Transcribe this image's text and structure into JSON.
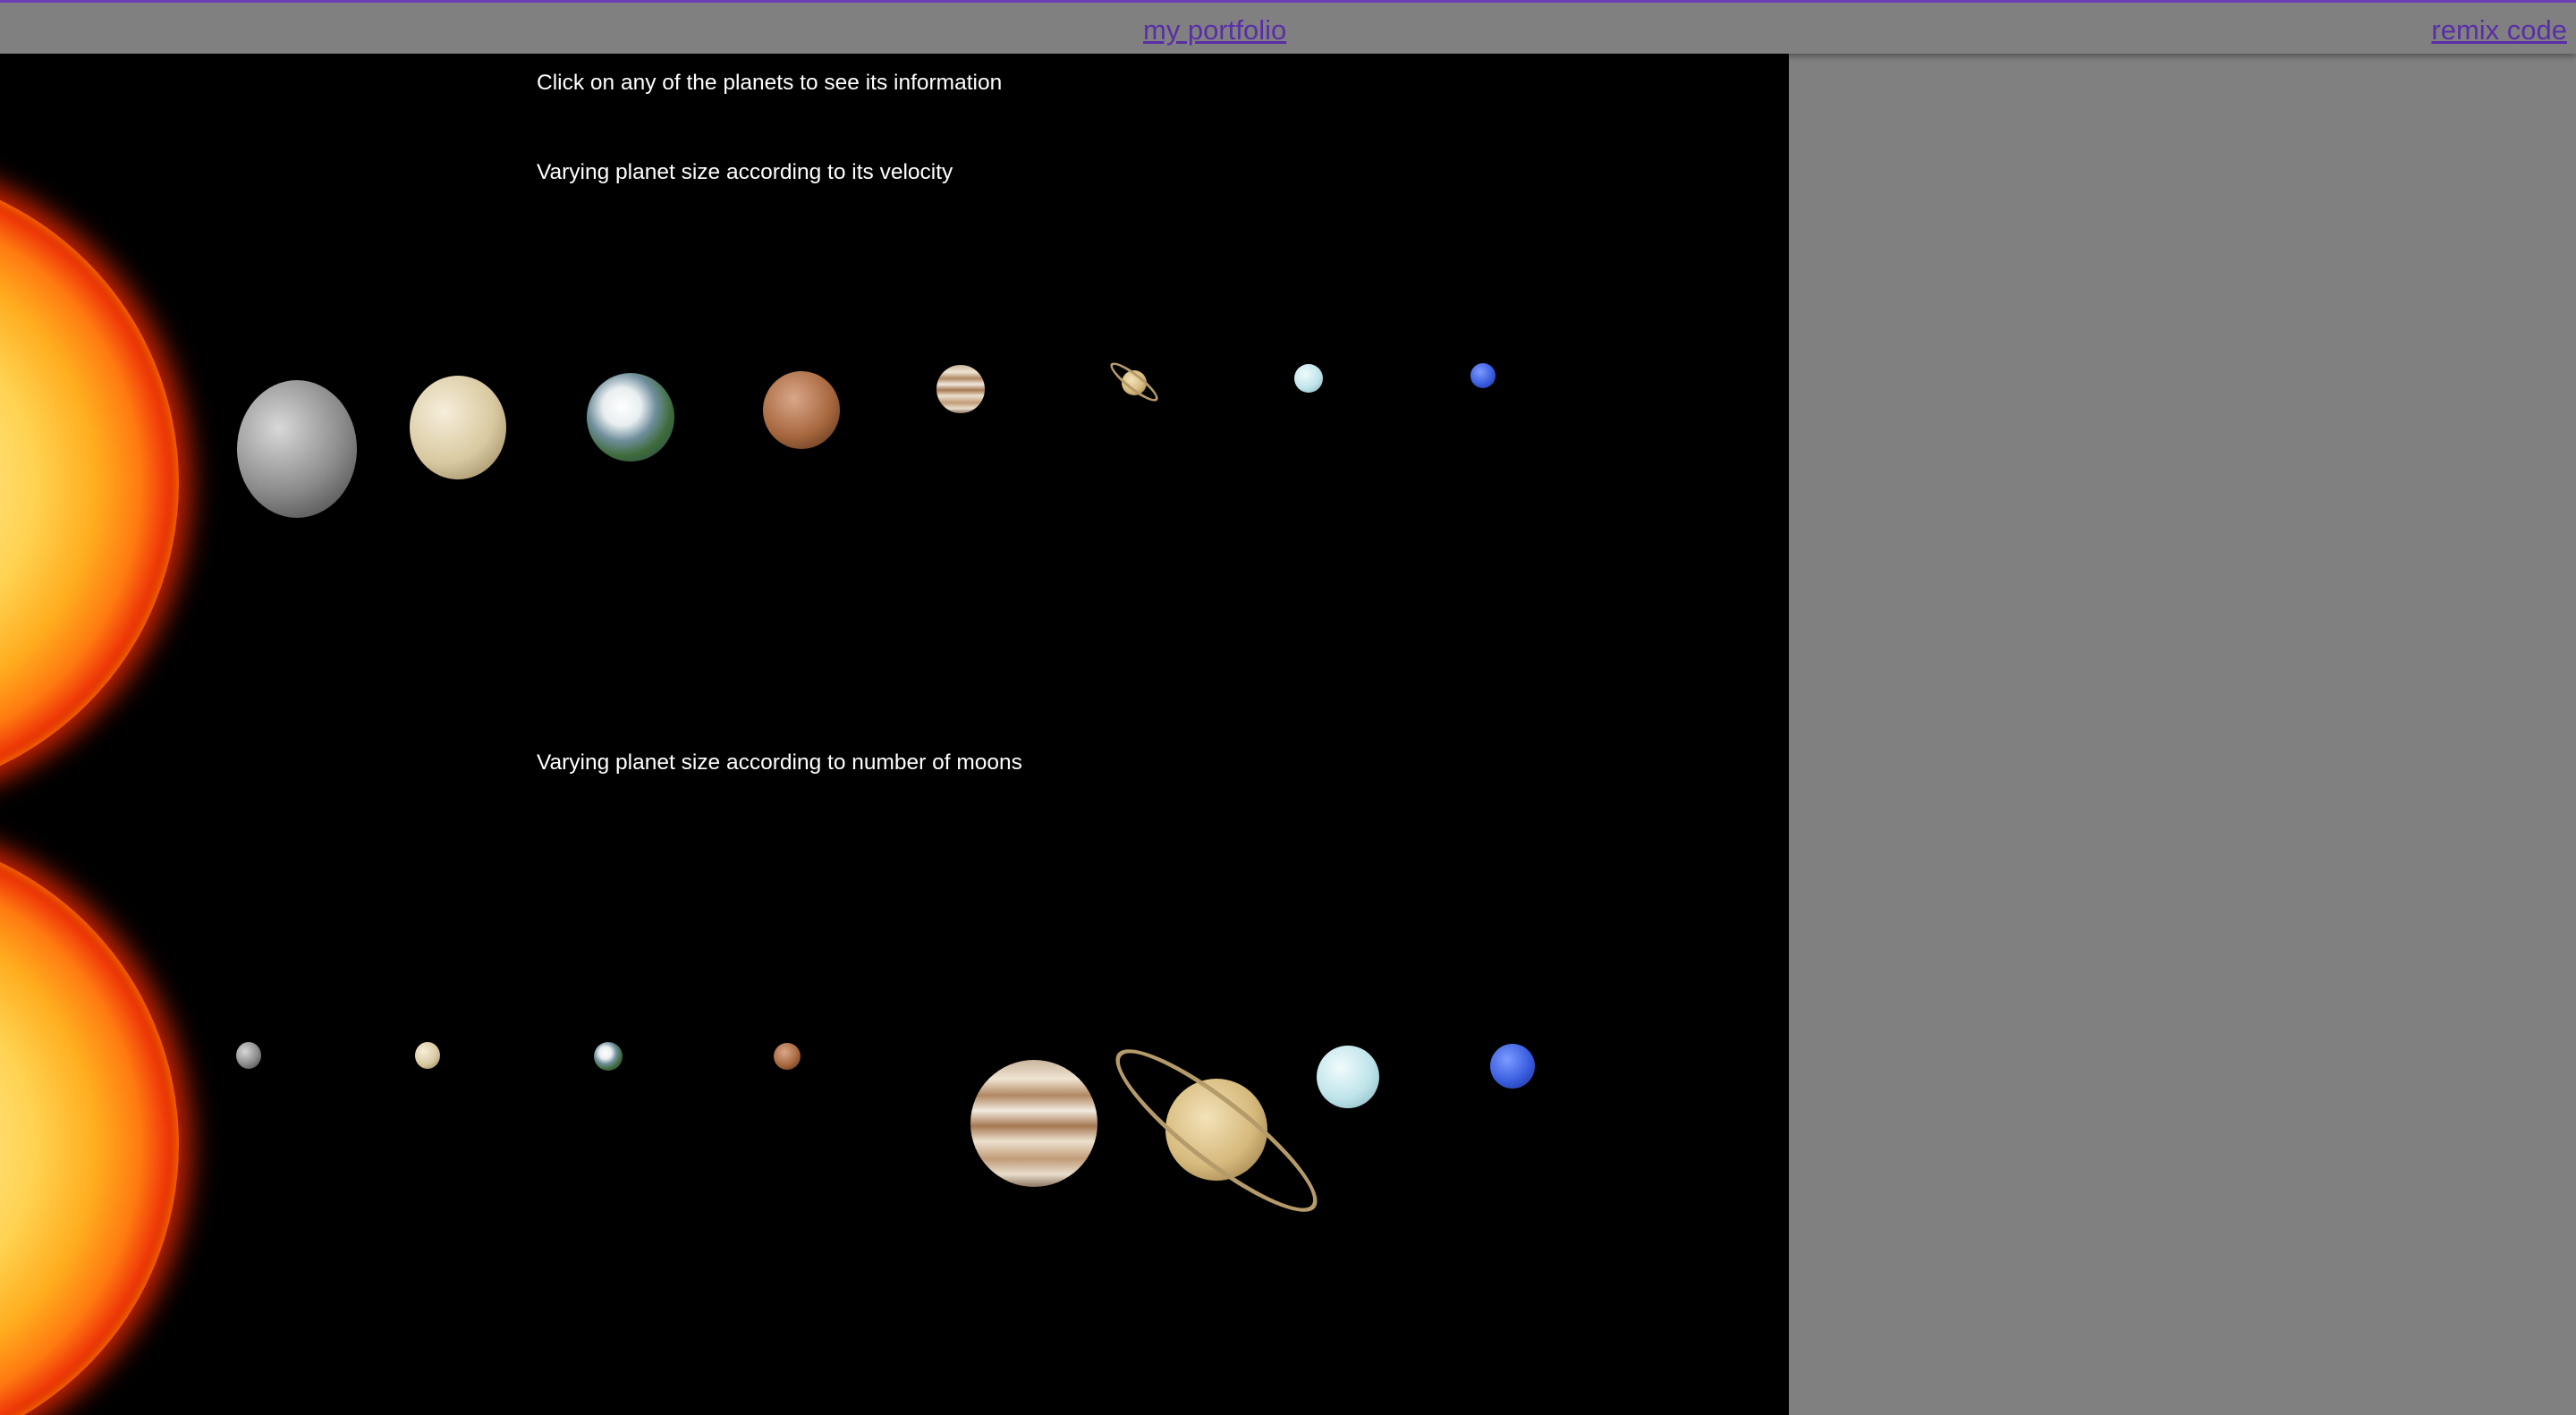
{
  "nav": {
    "portfolio_link": "my portfolio",
    "remix_link": "remix code"
  },
  "captions": {
    "instruction": "Click on any of the planets to see its information",
    "velocity_heading": "Varying planet size according to its velocity",
    "moons_heading": "Varying planet size according to number of moons"
  },
  "colors": {
    "page_background": "#808080",
    "link_color": "#5a2ea6",
    "stage_background": "#000000",
    "caption_text": "#ffffff",
    "top_border": "#6a3fb5"
  },
  "planet_order": [
    "Mercury",
    "Venus",
    "Earth",
    "Mars",
    "Jupiter",
    "Saturn",
    "Uranus",
    "Neptune"
  ]
}
